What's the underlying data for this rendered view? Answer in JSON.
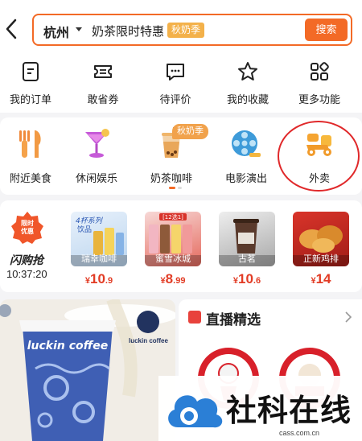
{
  "header": {
    "back_icon": "chevron-left-icon",
    "city": "杭州",
    "search_text": "奶茶限时特惠",
    "search_tag": "秋奶季",
    "search_button": "搜索",
    "accent": "#f36a26"
  },
  "quick_actions": [
    {
      "label": "我的订单",
      "icon": "order-list-icon"
    },
    {
      "label": "敢省券",
      "icon": "coupon-icon"
    },
    {
      "label": "待评价",
      "icon": "comment-icon"
    },
    {
      "label": "我的收藏",
      "icon": "star-icon"
    },
    {
      "label": "更多功能",
      "icon": "grid-icon"
    }
  ],
  "categories": [
    {
      "label": "附近美食",
      "icon": "fork-knife-icon"
    },
    {
      "label": "休闲娱乐",
      "icon": "cocktail-icon"
    },
    {
      "label": "奶茶咖啡",
      "icon": "milk-tea-icon",
      "badge": "秋奶季"
    },
    {
      "label": "电影演出",
      "icon": "film-reel-icon"
    },
    {
      "label": "外卖",
      "icon": "scooter-icon"
    }
  ],
  "flash_sale": {
    "badge": "限时优惠",
    "title": "闪购抢",
    "countdown": "10:37:20",
    "items": [
      {
        "name": "瑞幸咖啡",
        "price_int": "10",
        "price_dec": ".9"
      },
      {
        "name": "蜜雪冰城",
        "price_int": "8",
        "price_dec": ".99"
      },
      {
        "name": "古茗",
        "price_int": "10",
        "price_dec": ".6"
      },
      {
        "name": "正新鸡排",
        "price_int": "14",
        "price_dec": ""
      }
    ],
    "currency": "¥"
  },
  "promo": {
    "cup_text": "luckin coffee",
    "logo_text": "luckin coffee"
  },
  "live": {
    "title": "直播精选"
  },
  "watermark": {
    "text": "社科在线",
    "url": "cass.com.cn"
  }
}
